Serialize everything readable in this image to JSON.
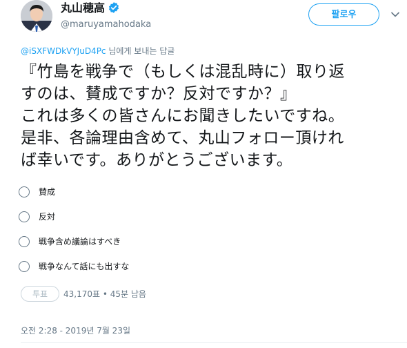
{
  "user": {
    "display_name": "丸山穂高",
    "handle": "@maruyamahodaka",
    "verified": true,
    "avatar": "avatar-photo"
  },
  "header": {
    "follow_label": "팔로우",
    "menu_icon": "chevron-down-icon"
  },
  "reply": {
    "mention": "@iSXFWDkVYJuD4Pc",
    "suffix": " 님에게 보내는 답글"
  },
  "tweet": {
    "lines": [
      "『竹島を戦争で（もしくは混乱時に）取り返",
      "すのは、賛成ですか？反対ですか？』",
      "これは多くの皆さんにお聞きしたいですね。",
      "是非、各論理由含めて、丸山フォロー頂けれ",
      "ば幸いです。ありがとうございます。"
    ]
  },
  "poll": {
    "options": [
      {
        "label": "賛成"
      },
      {
        "label": "反対"
      },
      {
        "label": "戦争含め議論はすべき"
      },
      {
        "label": "戦争なんて話にも出すな"
      }
    ],
    "vote_label": "투표",
    "meta": "43,170표 • 45분 남음"
  },
  "timestamp": "오전 2:28 - 2019년 7월 23일",
  "colors": {
    "accent": "#1da1f2",
    "muted": "#657786",
    "text": "#14171a"
  }
}
